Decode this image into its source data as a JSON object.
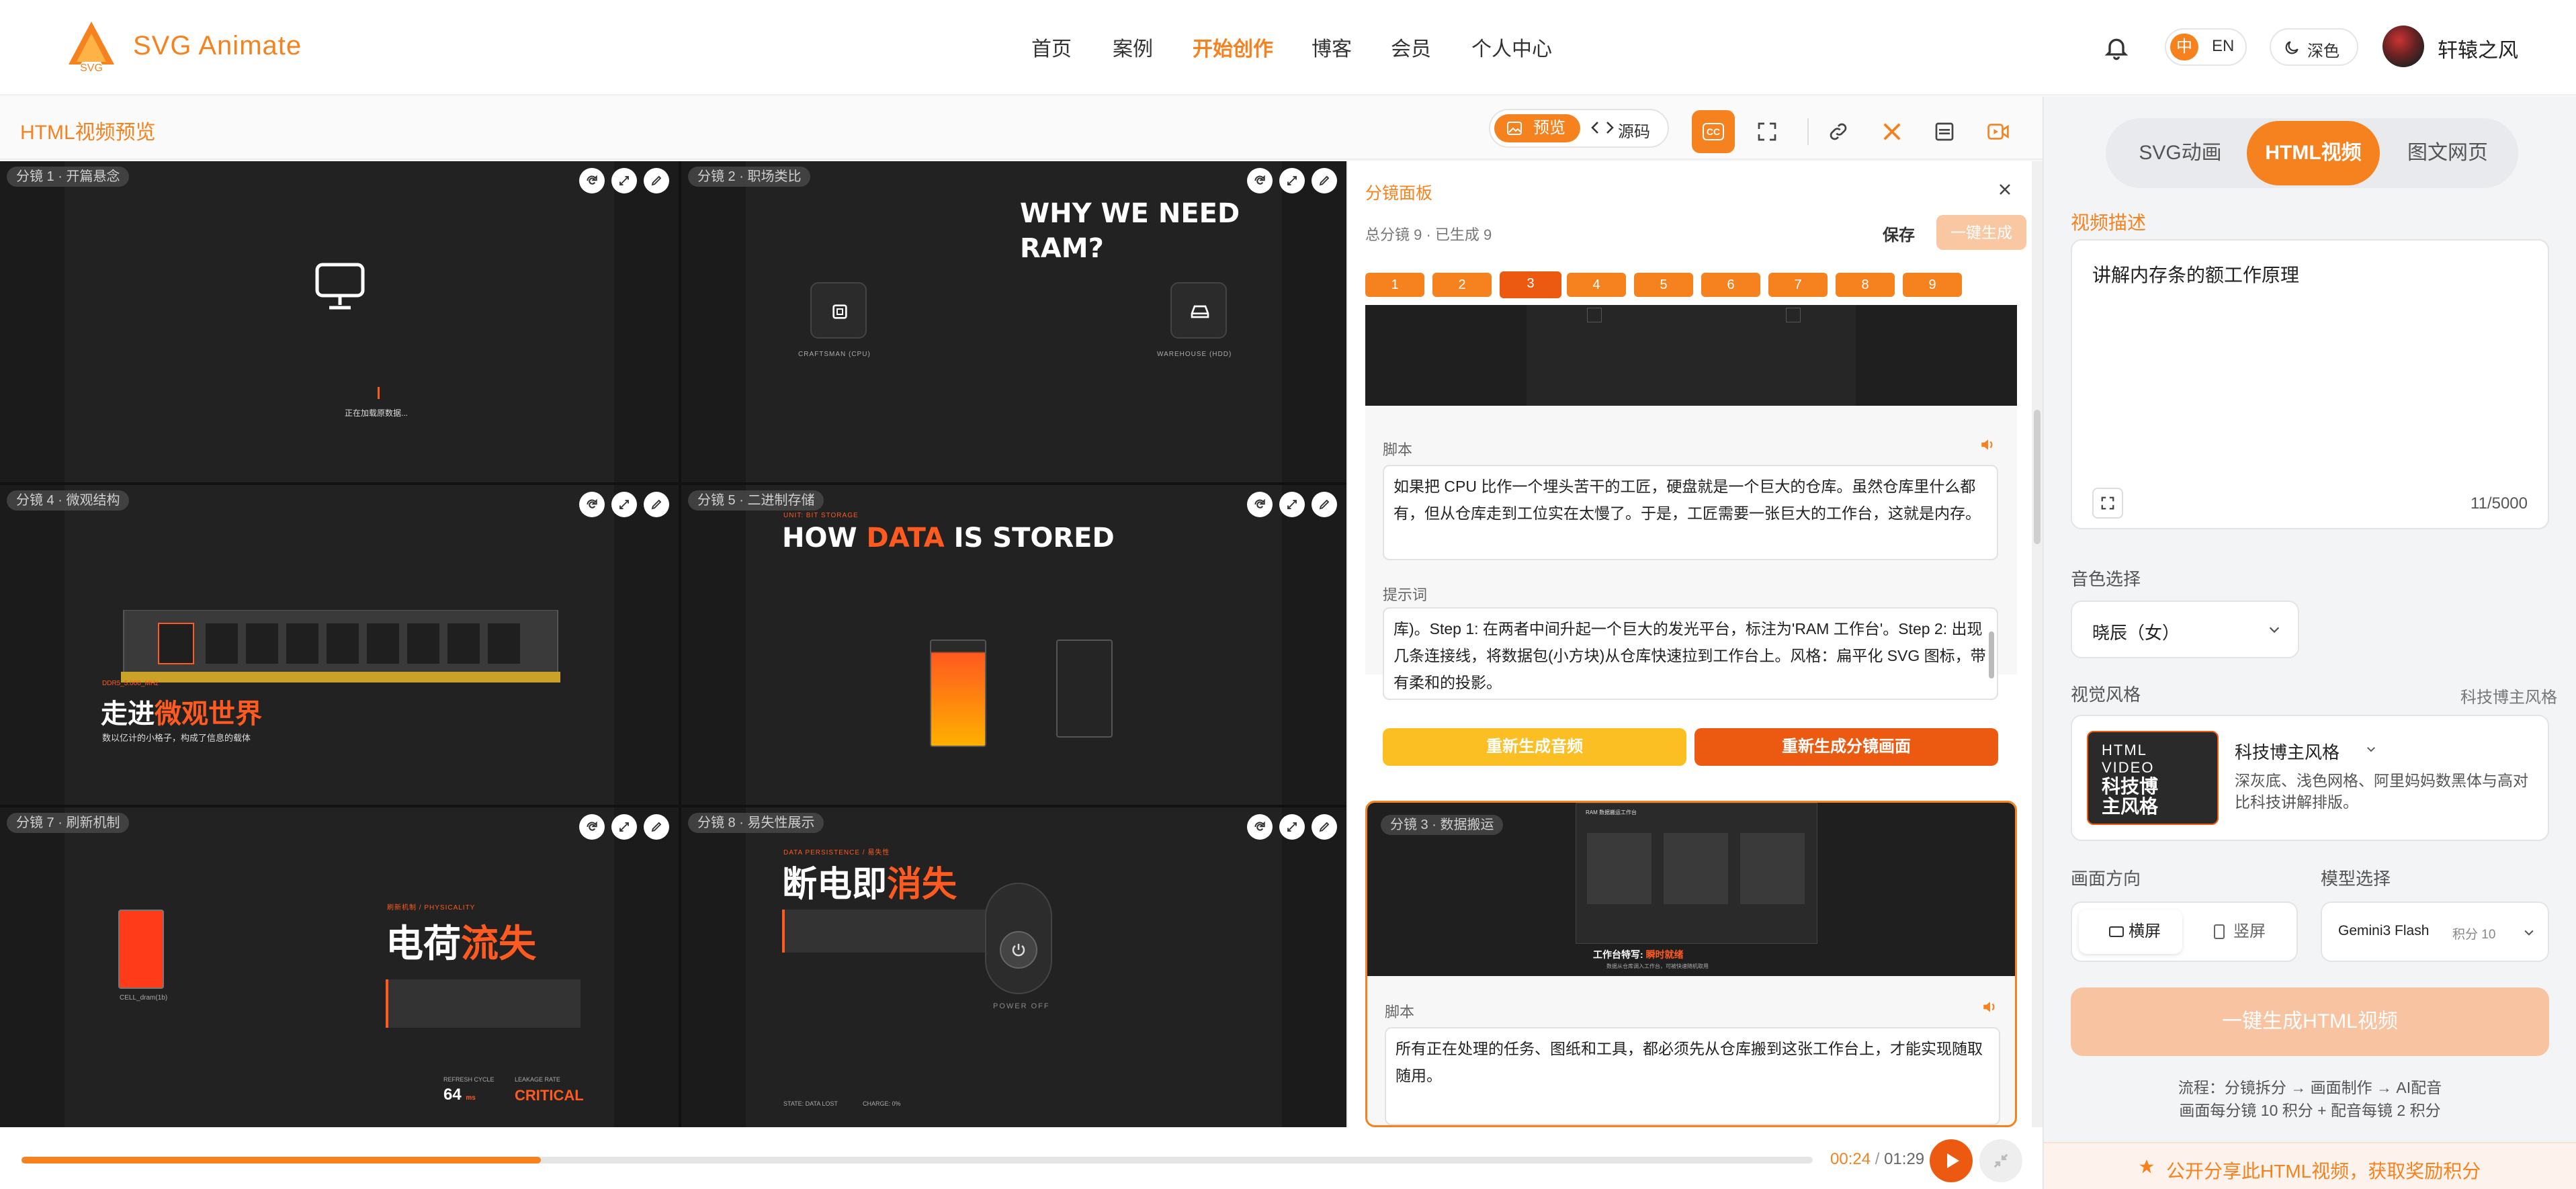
{
  "brand": {
    "name": "SVG Animate",
    "logo_text": "SVG"
  },
  "nav": {
    "items": [
      "首页",
      "案例",
      "开始创作",
      "博客",
      "会员",
      "个人中心"
    ],
    "active": "开始创作"
  },
  "header_right": {
    "lang_zh": "中",
    "lang_en": "EN",
    "theme": "深色",
    "username": "轩辕之风"
  },
  "preview": {
    "title": "HTML视频预览",
    "toggle_preview": "预览",
    "toggle_source": "源码",
    "cc_label": "CC"
  },
  "scenes": [
    {
      "label": "分镜 1 · 开篇悬念",
      "caption": "正在加载原数据..."
    },
    {
      "label": "分镜 2 · 职场类比",
      "title": "WHY WE NEED RAM?",
      "chip_left": "CRAFTSMAN (CPU)",
      "chip_right": "WAREHOUSE (HDD)"
    },
    {
      "label": "分镜 4 · 微观结构",
      "title_white": "走进",
      "title_orange": "微观世界",
      "sub": "数以亿计的小格子，构成了信息的载体",
      "tag": "DDR5_5.000_MHz"
    },
    {
      "label": "分镜 5 · 二进制存储",
      "kicker": "UNIT: BIT STORAGE",
      "title_a": "HOW ",
      "title_b": "DATA",
      "title_c": " IS STORED"
    },
    {
      "label": "分镜 7 · 刷新机制",
      "kicker": "刷新机制 / PHYSICALITY",
      "title_white": "电荷",
      "title_orange": "流失",
      "cell_label": "CELL_dram(1b)",
      "stat1_label": "REFRESH CYCLE",
      "stat1_value": "64",
      "stat1_unit": "ms",
      "stat2_label": "LEAKAGE RATE",
      "stat2_value": "CRITICAL"
    },
    {
      "label": "分镜 8 · 易失性展示",
      "kicker": "DATA PERSISTENCE / 易失性",
      "title_white": "断电即",
      "title_orange": "消失",
      "power_label": "POWER OFF",
      "state": "STATE: DATA LOST",
      "charge": "CHARGE: 0%"
    }
  ],
  "player": {
    "current": "00:24",
    "total": "01:29",
    "progress": 0.29
  },
  "storyboard": {
    "title": "分镜面板",
    "stats": "总分镜 9 · 已生成 9",
    "save": "保存",
    "generate_all": "一键生成",
    "tabs": [
      "1",
      "2",
      "3",
      "4",
      "5",
      "6",
      "7",
      "8",
      "9"
    ],
    "active_tab": "3",
    "script_label": "脚本",
    "script_text": "如果把 CPU 比作一个埋头苦干的工匠，硬盘就是一个巨大的仓库。虽然仓库里什么都有，但从仓库走到工位实在太慢了。于是，工匠需要一张巨大的工作台，这就是内存。",
    "prompt_label": "提示词",
    "prompt_text": "库)。Step 1: 在两者中间升起一个巨大的发光平台，标注为'RAM 工作台'。Step 2: 出现几条连接线，将数据包(小方块)从仓库快速拉到工作台上。风格：扁平化 SVG 图标，带有柔和的投影。",
    "btn_audio": "重新生成音频",
    "btn_scene": "重新生成分镜画面",
    "card3_label": "分镜 3 · 数据搬运",
    "card3_window": "RAM 数据搬运工作台",
    "card3_caption_white": "工作台特写: ",
    "card3_caption_orange": "瞬时就绪",
    "card3_sub": "数据从仓库调入工作台，可被快速随机取用",
    "card3_script_label": "脚本",
    "card3_script": "所有正在处理的任务、图纸和工具，都必须先从仓库搬到这张工作台上，才能实现随取随用。"
  },
  "sidebar": {
    "tabs": [
      "SVG动画",
      "HTML视频",
      "图文网页"
    ],
    "active_tab": "HTML视频",
    "desc_label": "视频描述",
    "desc_value": "讲解内存条的额工作原理",
    "counter": "11/5000",
    "voice_label": "音色选择",
    "voice_value": "晓辰（女）",
    "style_label": "视觉风格",
    "style_right": "科技博主风格",
    "style_name": "科技博主风格",
    "style_desc": "深灰底、浅色网格、阿里妈妈数黑体与高对比科技讲解排版。",
    "style_thumb_l1": "HTML",
    "style_thumb_l2": "VIDEO",
    "style_thumb_l3": "科技博",
    "style_thumb_l4": "主风格",
    "orient_label": "画面方向",
    "orient_h": "横屏",
    "orient_v": "竖屏",
    "model_label": "模型选择",
    "model_value": "Gemini3 Flash",
    "model_cost": "积分 10",
    "generate_btn": "一键生成HTML视频",
    "flow": "流程：分镜拆分 → 画面制作 → AI配音",
    "pricing": "画面每分镜 10 积分 + 配音每镜 2 积分",
    "share": "公开分享此HTML视频，获取奖励积分"
  },
  "colors": {
    "accent": "#f5821f",
    "accent_deep": "#ec5a12",
    "accent_light": "#f9c7a2",
    "dark": "#1b1b1b",
    "yellow": "#fbbf24"
  }
}
